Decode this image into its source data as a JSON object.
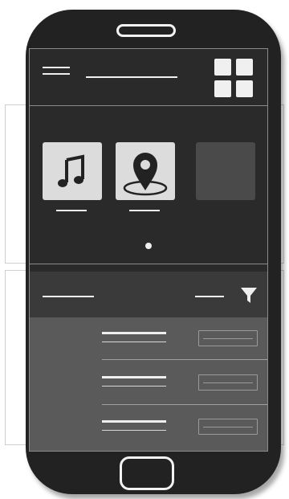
{
  "app": {
    "menu_icon": "hamburger-icon",
    "grid_icon": "grid-icon"
  },
  "carousel": {
    "items": [
      {
        "icon": "music-note-icon",
        "label": ""
      },
      {
        "icon": "map-pin-icon",
        "label": ""
      },
      {
        "icon": "",
        "label": ""
      }
    ],
    "page_indicator": "dot"
  },
  "filter": {
    "icon": "filter-icon"
  },
  "list": {
    "rows": [
      {
        "title": "",
        "subtitle": "",
        "value": ""
      },
      {
        "title": "",
        "subtitle": "",
        "value": ""
      },
      {
        "title": "",
        "subtitle": "",
        "value": ""
      }
    ]
  },
  "colors": {
    "phone_body": "#222222",
    "screen": "#2a2a2a",
    "tile_light": "#dcdcdc",
    "tile_dark": "#4a4a4a",
    "list_bg": "#5a5a5a",
    "filter_bar": "#3a3a3a"
  }
}
